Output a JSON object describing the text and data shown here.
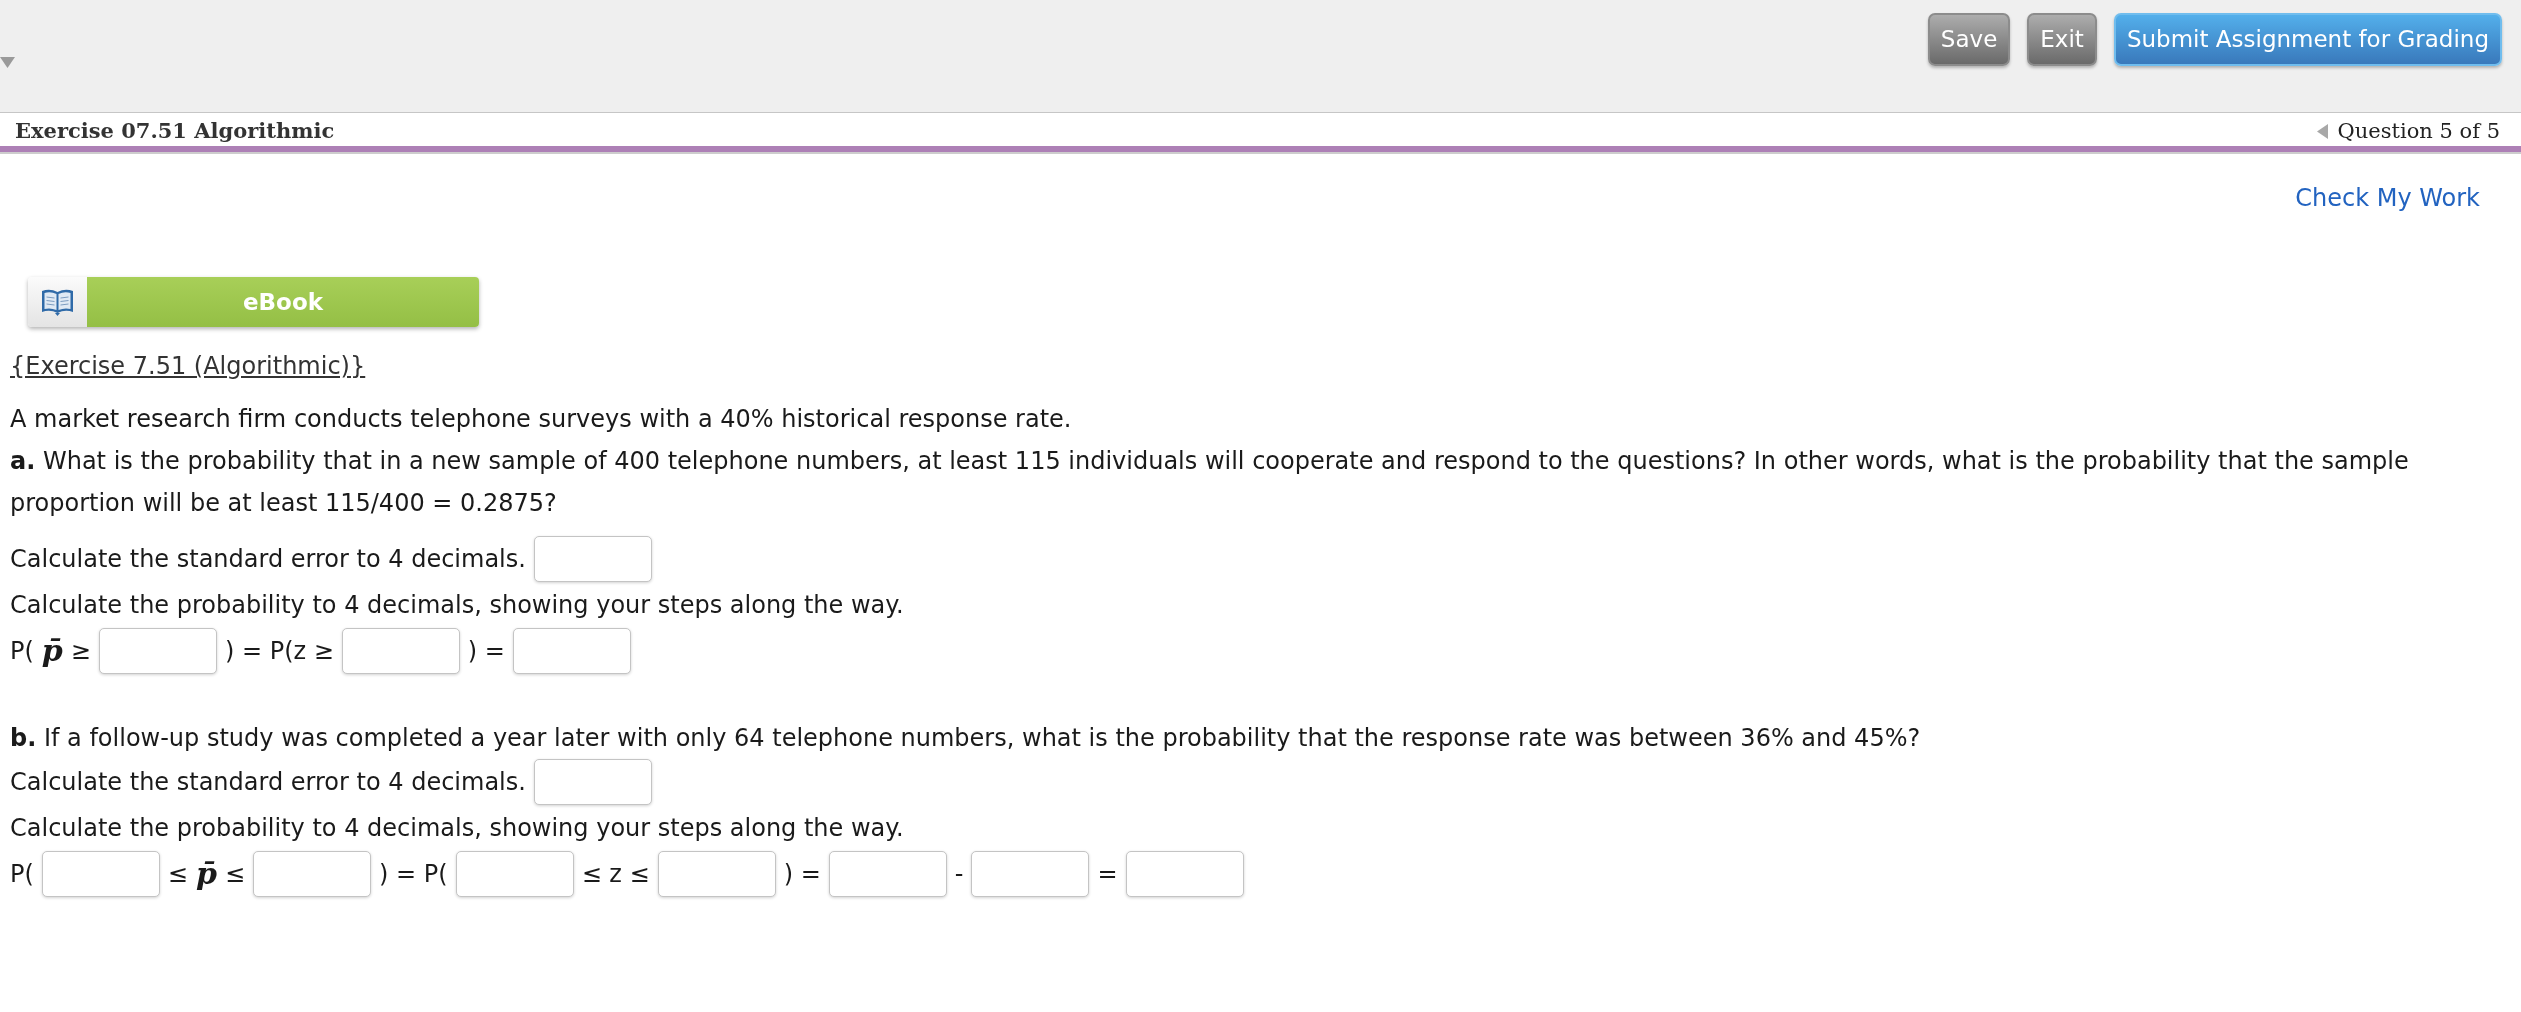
{
  "toolbar": {
    "buttons": [
      {
        "label": "Save",
        "kind": "secondary"
      },
      {
        "label": "Exit",
        "kind": "secondary"
      },
      {
        "label": "Submit Assignment for Grading",
        "kind": "primary"
      }
    ]
  },
  "header": {
    "title": "Exercise 07.51 Algorithmic",
    "question_nav": "Question 5 of 5"
  },
  "check_my_work": {
    "label": "Check My Work"
  },
  "ebook_button": {
    "label": "eBook"
  },
  "exercise_link": {
    "label": "{Exercise 7.51 (Algorithmic)}"
  },
  "intro": "A market research firm conducts telephone surveys with a 40% historical response rate.",
  "parts": [
    {
      "question": "**a.** What is the probability that in a new sample of 400 telephone numbers, at least 115 individuals will cooperate and respond to the questions? In other words, what is the probability that the sample proportion will be at least 115/400 = 0.2875?",
      "rows": [
        {
          "items": [
            {
              "kind": "text",
              "text": "Calculate the standard error to 4 decimals."
            },
            {
              "kind": "input"
            }
          ]
        },
        {
          "items": [
            {
              "kind": "text",
              "text": "Calculate the probability to 4 decimals, showing your steps along the way."
            }
          ]
        },
        {
          "items": [
            {
              "kind": "math",
              "text": "P("
            },
            {
              "kind": "symbol",
              "text": "p̄"
            },
            {
              "kind": "math",
              "text": "≥"
            },
            {
              "kind": "input"
            },
            {
              "kind": "math",
              "text": ") = P(z ≥"
            },
            {
              "kind": "input"
            },
            {
              "kind": "math",
              "text": ") ="
            },
            {
              "kind": "input"
            }
          ]
        }
      ]
    },
    {
      "question": "**b.** If a follow-up study was completed a year later with only 64 telephone numbers, what is the probability that the response rate was between 36% and 45%?",
      "rows": [
        {
          "items": [
            {
              "kind": "text",
              "text": "Calculate the standard error to 4 decimals."
            },
            {
              "kind": "input"
            }
          ]
        },
        {
          "items": [
            {
              "kind": "text",
              "text": "Calculate the probability to 4 decimals, showing your steps along the way."
            }
          ]
        },
        {
          "items": [
            {
              "kind": "math",
              "text": "P("
            },
            {
              "kind": "input"
            },
            {
              "kind": "math",
              "text": "≤"
            },
            {
              "kind": "symbol",
              "text": "p̄"
            },
            {
              "kind": "math",
              "text": "≤"
            },
            {
              "kind": "input"
            },
            {
              "kind": "math",
              "text": ") = P("
            },
            {
              "kind": "input"
            },
            {
              "kind": "math",
              "text": "≤ z ≤"
            },
            {
              "kind": "input"
            },
            {
              "kind": "math",
              "text": ") ="
            },
            {
              "kind": "input"
            },
            {
              "kind": "math",
              "text": "-"
            },
            {
              "kind": "input"
            },
            {
              "kind": "math",
              "text": "="
            },
            {
              "kind": "input"
            }
          ]
        }
      ]
    }
  ]
}
